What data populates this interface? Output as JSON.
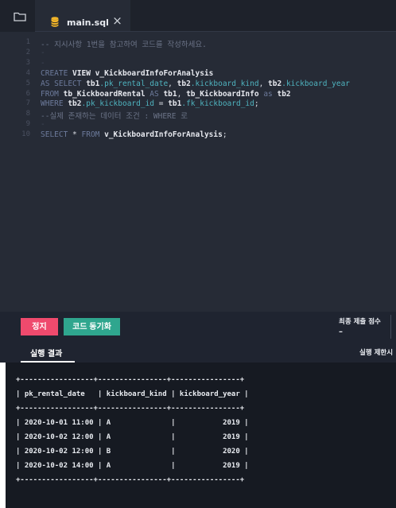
{
  "tab": {
    "filename": "main.sql",
    "icons": [
      "folder-icon",
      "database-icon",
      "close-icon"
    ]
  },
  "editor": {
    "line_numbers": [
      "1",
      "2",
      "3",
      "4",
      "5",
      "6",
      "7",
      "8",
      "9",
      "10"
    ],
    "lines": [
      [
        {
          "t": "-- 지시사항 1번을 참고하여 코드를 작성하세요.",
          "c": "cm"
        }
      ],
      [
        {
          "t": "-",
          "c": "ws"
        }
      ],
      [
        {
          "t": "-",
          "c": "ws"
        }
      ],
      [
        {
          "t": "CREATE ",
          "c": "kw"
        },
        {
          "t": "VIEW ",
          "c": "ident"
        },
        {
          "t": "v_KickboardInfoForAnalysis",
          "c": "ident"
        }
      ],
      [
        {
          "t": "AS SELECT ",
          "c": "kw"
        },
        {
          "t": "tb1",
          "c": "ident"
        },
        {
          "t": ".pk_rental_date",
          "c": "col"
        },
        {
          "t": ", ",
          "c": "op"
        },
        {
          "t": "tb2",
          "c": "ident"
        },
        {
          "t": ".kickboard_kind",
          "c": "col"
        },
        {
          "t": ", ",
          "c": "op"
        },
        {
          "t": "tb2",
          "c": "ident"
        },
        {
          "t": ".kickboard_year",
          "c": "col"
        }
      ],
      [
        {
          "t": "FROM ",
          "c": "kw"
        },
        {
          "t": "tb_KickboardRental",
          "c": "ident"
        },
        {
          "t": " AS ",
          "c": "kw"
        },
        {
          "t": "tb1",
          "c": "ident"
        },
        {
          "t": ", ",
          "c": "op"
        },
        {
          "t": "tb_KickboardInfo",
          "c": "ident"
        },
        {
          "t": " as ",
          "c": "kw"
        },
        {
          "t": "tb2",
          "c": "ident"
        }
      ],
      [
        {
          "t": "WHERE ",
          "c": "kw"
        },
        {
          "t": "tb2",
          "c": "ident"
        },
        {
          "t": ".pk_kickboard_id",
          "c": "col"
        },
        {
          "t": " = ",
          "c": "op"
        },
        {
          "t": "tb1",
          "c": "ident"
        },
        {
          "t": ".fk_kickboard_id",
          "c": "col"
        },
        {
          "t": ";",
          "c": "op"
        }
      ],
      [
        {
          "t": "--실제 존재하는 데이터 조건 : WHERE 로",
          "c": "cm"
        }
      ],
      [
        {
          "t": "-",
          "c": "ws"
        }
      ],
      [
        {
          "t": "SELECT ",
          "c": "kw"
        },
        {
          "t": "* ",
          "c": "op"
        },
        {
          "t": "FROM ",
          "c": "kw"
        },
        {
          "t": "v_KickboardInfoForAnalysis",
          "c": "ident"
        },
        {
          "t": ";",
          "c": "op"
        }
      ]
    ]
  },
  "controls": {
    "stop_label": "정지",
    "sync_label": "코드 동기화",
    "score_label": "최종 제출 점수",
    "score_value": "–"
  },
  "results": {
    "tab_label": "실행 결과",
    "limit_label": "실행 제한시",
    "output_lines": [
      "+-----------------+----------------+----------------+",
      "| pk_rental_date   | kickboard_kind | kickboard_year |",
      "+-----------------+----------------+----------------+",
      "| 2020-10-01 11:00 | A              |           2019 |",
      "| 2020-10-02 12:00 | A              |           2019 |",
      "| 2020-10-02 12:00 | B              |           2020 |",
      "| 2020-10-02 14:00 | A              |           2019 |",
      "+-----------------+----------------+----------------+"
    ]
  },
  "colors": {
    "editor_bg": "#262b36",
    "stop_button": "#ef4a6d",
    "sync_button": "#2fa68e",
    "output_bg": "#161a22"
  }
}
